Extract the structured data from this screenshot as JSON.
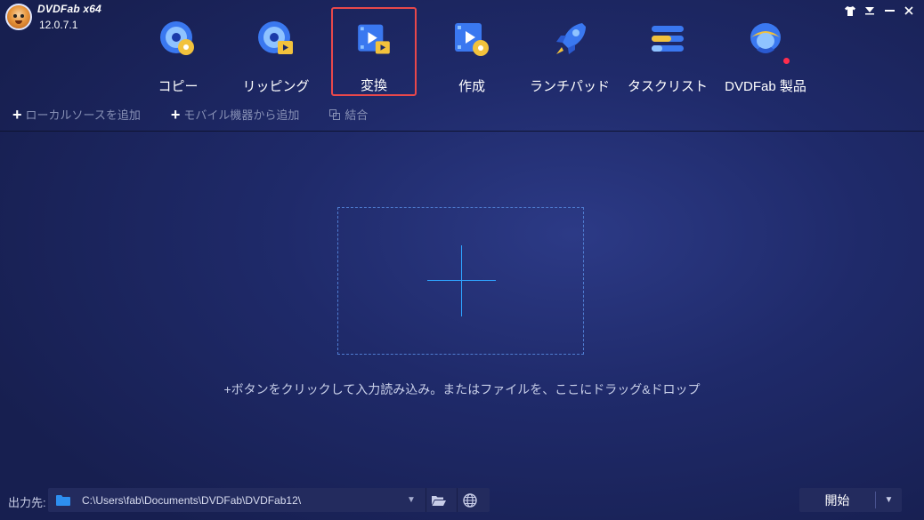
{
  "app": {
    "name": "DVDFab x64",
    "version": "12.0.7.1"
  },
  "window_controls": [
    {
      "name": "skin-icon",
      "glyph": "👕"
    },
    {
      "name": "menu-icon",
      "glyph": "▾"
    },
    {
      "name": "minimize-icon",
      "glyph": "▬"
    },
    {
      "name": "close-icon",
      "glyph": "✕"
    }
  ],
  "modules": [
    {
      "label": "コピー",
      "icon": "disc-copy-icon",
      "active": false
    },
    {
      "label": "リッピング",
      "icon": "disc-ripper-icon",
      "active": false
    },
    {
      "label": "変換",
      "icon": "video-converter-icon",
      "active": true
    },
    {
      "label": "作成",
      "icon": "disc-creator-icon",
      "active": false
    },
    {
      "label": "ランチパッド",
      "icon": "rocket-icon",
      "active": false
    },
    {
      "label": "タスクリスト",
      "icon": "task-list-icon",
      "active": false
    },
    {
      "label": "DVDFab 製品",
      "icon": "products-icon",
      "active": false,
      "notification_dot": true
    }
  ],
  "toolbar": {
    "add_local": "ローカルソースを追加",
    "add_mobile": "モバイル機器から追加",
    "merge": "結合"
  },
  "dropzone": {
    "hint": "+ボタンをクリックして入力読み込み。またはファイルを、ここにドラッグ&ドロップ"
  },
  "output": {
    "label": "出力先:",
    "path": "C:\\Users\\fab\\Documents\\DVDFab\\DVDFab12\\"
  },
  "start_button": {
    "label": "開始"
  },
  "colors": {
    "accent_red": "#e8484b",
    "accent_blue": "#2ea3ff",
    "background": "#1f2a6a",
    "notification_dot": "#ff2d4d"
  }
}
